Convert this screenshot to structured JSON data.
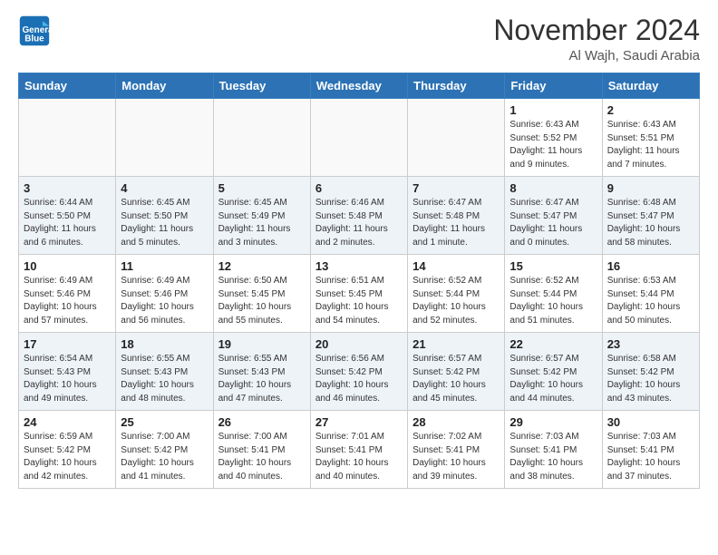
{
  "header": {
    "logo_line1": "General",
    "logo_line2": "Blue",
    "month": "November 2024",
    "location": "Al Wajh, Saudi Arabia"
  },
  "weekdays": [
    "Sunday",
    "Monday",
    "Tuesday",
    "Wednesday",
    "Thursday",
    "Friday",
    "Saturday"
  ],
  "weeks": [
    [
      {
        "day": "",
        "empty": true
      },
      {
        "day": "",
        "empty": true
      },
      {
        "day": "",
        "empty": true
      },
      {
        "day": "",
        "empty": true
      },
      {
        "day": "",
        "empty": true
      },
      {
        "day": "1",
        "sunrise": "6:43 AM",
        "sunset": "5:52 PM",
        "daylight": "11 hours and 9 minutes."
      },
      {
        "day": "2",
        "sunrise": "6:43 AM",
        "sunset": "5:51 PM",
        "daylight": "11 hours and 7 minutes."
      }
    ],
    [
      {
        "day": "3",
        "sunrise": "6:44 AM",
        "sunset": "5:50 PM",
        "daylight": "11 hours and 6 minutes."
      },
      {
        "day": "4",
        "sunrise": "6:45 AM",
        "sunset": "5:50 PM",
        "daylight": "11 hours and 5 minutes."
      },
      {
        "day": "5",
        "sunrise": "6:45 AM",
        "sunset": "5:49 PM",
        "daylight": "11 hours and 3 minutes."
      },
      {
        "day": "6",
        "sunrise": "6:46 AM",
        "sunset": "5:48 PM",
        "daylight": "11 hours and 2 minutes."
      },
      {
        "day": "7",
        "sunrise": "6:47 AM",
        "sunset": "5:48 PM",
        "daylight": "11 hours and 1 minute."
      },
      {
        "day": "8",
        "sunrise": "6:47 AM",
        "sunset": "5:47 PM",
        "daylight": "11 hours and 0 minutes."
      },
      {
        "day": "9",
        "sunrise": "6:48 AM",
        "sunset": "5:47 PM",
        "daylight": "10 hours and 58 minutes."
      }
    ],
    [
      {
        "day": "10",
        "sunrise": "6:49 AM",
        "sunset": "5:46 PM",
        "daylight": "10 hours and 57 minutes."
      },
      {
        "day": "11",
        "sunrise": "6:49 AM",
        "sunset": "5:46 PM",
        "daylight": "10 hours and 56 minutes."
      },
      {
        "day": "12",
        "sunrise": "6:50 AM",
        "sunset": "5:45 PM",
        "daylight": "10 hours and 55 minutes."
      },
      {
        "day": "13",
        "sunrise": "6:51 AM",
        "sunset": "5:45 PM",
        "daylight": "10 hours and 54 minutes."
      },
      {
        "day": "14",
        "sunrise": "6:52 AM",
        "sunset": "5:44 PM",
        "daylight": "10 hours and 52 minutes."
      },
      {
        "day": "15",
        "sunrise": "6:52 AM",
        "sunset": "5:44 PM",
        "daylight": "10 hours and 51 minutes."
      },
      {
        "day": "16",
        "sunrise": "6:53 AM",
        "sunset": "5:44 PM",
        "daylight": "10 hours and 50 minutes."
      }
    ],
    [
      {
        "day": "17",
        "sunrise": "6:54 AM",
        "sunset": "5:43 PM",
        "daylight": "10 hours and 49 minutes."
      },
      {
        "day": "18",
        "sunrise": "6:55 AM",
        "sunset": "5:43 PM",
        "daylight": "10 hours and 48 minutes."
      },
      {
        "day": "19",
        "sunrise": "6:55 AM",
        "sunset": "5:43 PM",
        "daylight": "10 hours and 47 minutes."
      },
      {
        "day": "20",
        "sunrise": "6:56 AM",
        "sunset": "5:42 PM",
        "daylight": "10 hours and 46 minutes."
      },
      {
        "day": "21",
        "sunrise": "6:57 AM",
        "sunset": "5:42 PM",
        "daylight": "10 hours and 45 minutes."
      },
      {
        "day": "22",
        "sunrise": "6:57 AM",
        "sunset": "5:42 PM",
        "daylight": "10 hours and 44 minutes."
      },
      {
        "day": "23",
        "sunrise": "6:58 AM",
        "sunset": "5:42 PM",
        "daylight": "10 hours and 43 minutes."
      }
    ],
    [
      {
        "day": "24",
        "sunrise": "6:59 AM",
        "sunset": "5:42 PM",
        "daylight": "10 hours and 42 minutes."
      },
      {
        "day": "25",
        "sunrise": "7:00 AM",
        "sunset": "5:42 PM",
        "daylight": "10 hours and 41 minutes."
      },
      {
        "day": "26",
        "sunrise": "7:00 AM",
        "sunset": "5:41 PM",
        "daylight": "10 hours and 40 minutes."
      },
      {
        "day": "27",
        "sunrise": "7:01 AM",
        "sunset": "5:41 PM",
        "daylight": "10 hours and 40 minutes."
      },
      {
        "day": "28",
        "sunrise": "7:02 AM",
        "sunset": "5:41 PM",
        "daylight": "10 hours and 39 minutes."
      },
      {
        "day": "29",
        "sunrise": "7:03 AM",
        "sunset": "5:41 PM",
        "daylight": "10 hours and 38 minutes."
      },
      {
        "day": "30",
        "sunrise": "7:03 AM",
        "sunset": "5:41 PM",
        "daylight": "10 hours and 37 minutes."
      }
    ]
  ],
  "labels": {
    "sunrise": "Sunrise:",
    "sunset": "Sunset:",
    "daylight": "Daylight:"
  }
}
